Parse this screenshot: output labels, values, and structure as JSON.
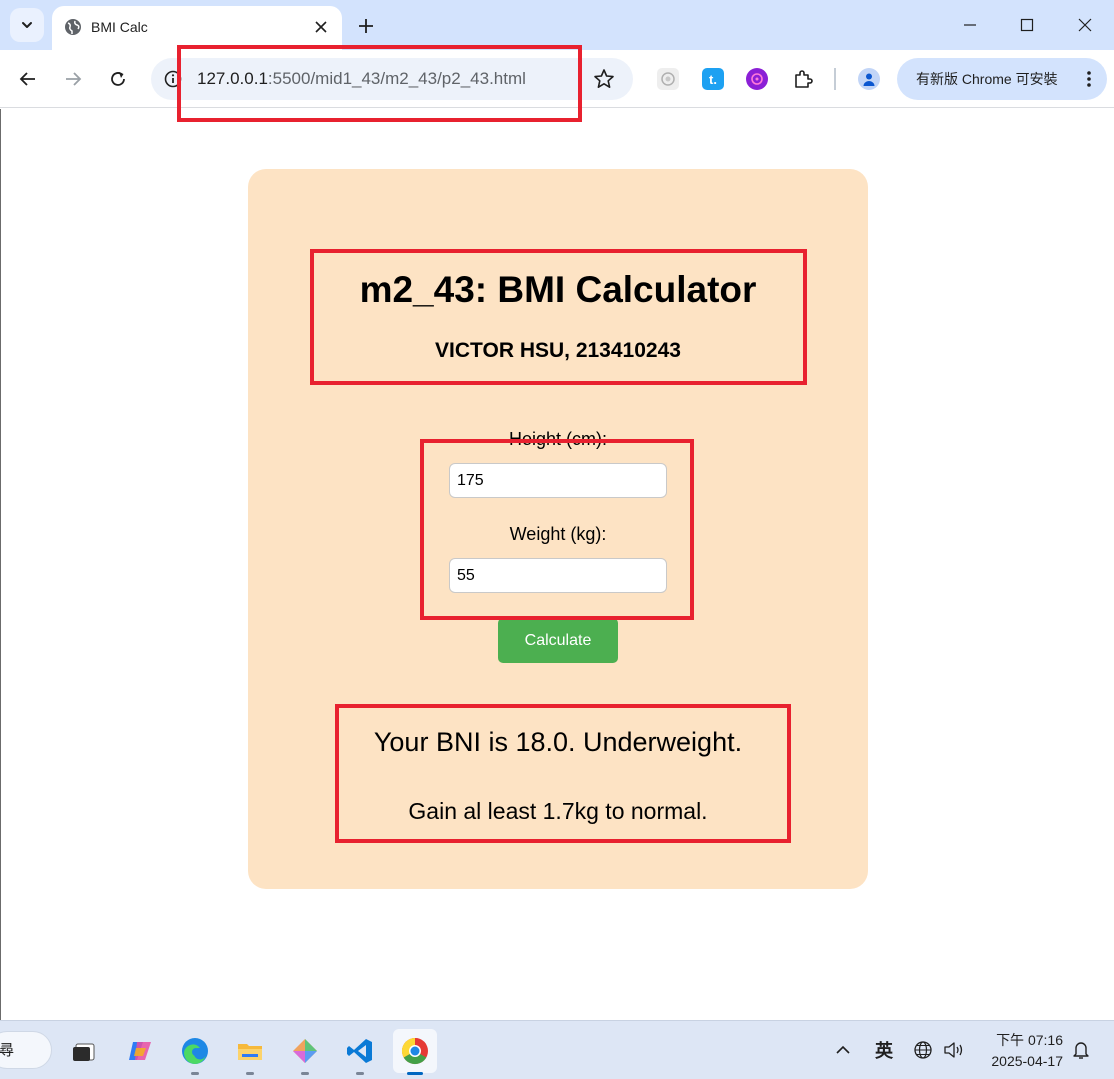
{
  "browser": {
    "tab_title": "BMI Calc",
    "url_host": "127.0.0.1",
    "url_rest": ":5500/mid1_43/m2_43/p2_43.html",
    "update_label": "有新版 Chrome 可安裝"
  },
  "page": {
    "title": "m2_43: BMI Calculator",
    "author": "VICTOR HSU, 213410243",
    "height_label": "Height (cm):",
    "height_value": "175",
    "weight_label": "Weight (kg):",
    "weight_value": "55",
    "calculate_label": "Calculate",
    "result_line1": "Your BNI is 18.0. Underweight.",
    "result_line2": "Gain al least 1.7kg to normal."
  },
  "taskbar": {
    "search_text": "尋",
    "ime_label": "英",
    "clock_time": "下午 07:16",
    "clock_date": "2025-04-17"
  },
  "colors": {
    "card": "#fde3c4",
    "button": "#4caf50",
    "highlight": "#e8212f",
    "tabstrip": "#d3e3fd"
  },
  "icons": [
    "tab-search-icon",
    "globe-icon",
    "close-icon",
    "plus-icon",
    "minimize-icon",
    "maximize-icon",
    "back-icon",
    "forward-icon",
    "reload-icon",
    "info-icon",
    "star-icon",
    "extension-icon",
    "profile-icon",
    "more-icon",
    "chevron-up-icon",
    "network-icon",
    "volume-icon",
    "bell-icon"
  ]
}
